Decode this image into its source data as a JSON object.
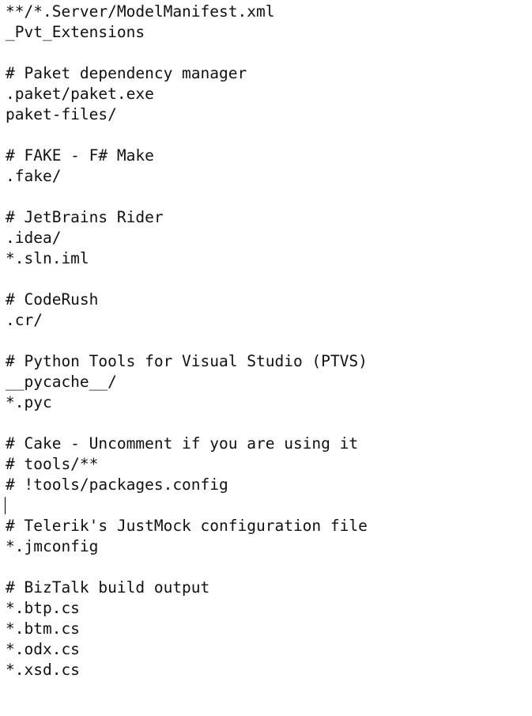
{
  "editor": {
    "lines": [
      "**/*.Server/ModelManifest.xml",
      "_Pvt_Extensions",
      "",
      "# Paket dependency manager",
      ".paket/paket.exe",
      "paket-files/",
      "",
      "# FAKE - F# Make",
      ".fake/",
      "",
      "# JetBrains Rider",
      ".idea/",
      "*.sln.iml",
      "",
      "# CodeRush",
      ".cr/",
      "",
      "# Python Tools for Visual Studio (PTVS)",
      "__pycache__/",
      "*.pyc",
      "",
      "# Cake - Uncomment if you are using it",
      "# tools/**",
      "# !tools/packages.config",
      "",
      "# Telerik's JustMock configuration file",
      "*.jmconfig",
      "",
      "# BizTalk build output",
      "*.btp.cs",
      "*.btm.cs",
      "*.odx.cs",
      "*.xsd.cs"
    ],
    "caret_line": 24
  }
}
